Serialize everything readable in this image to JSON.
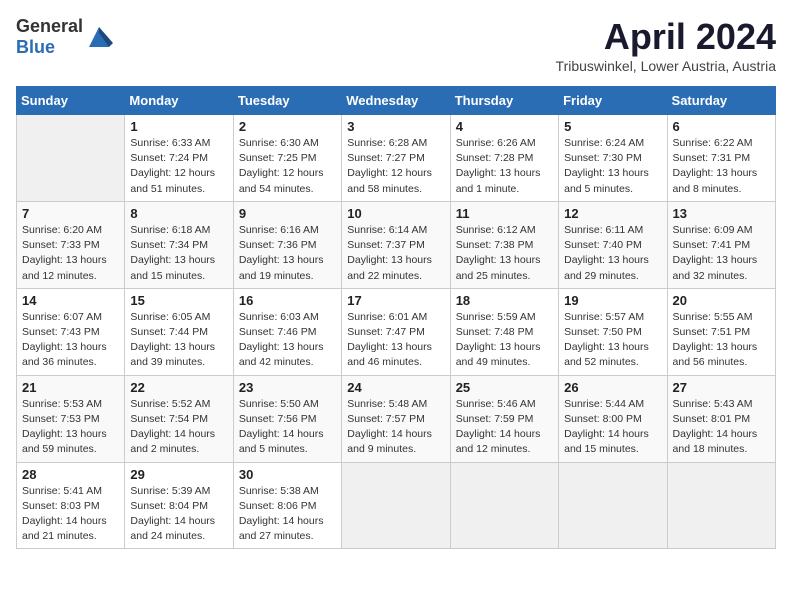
{
  "header": {
    "logo_general": "General",
    "logo_blue": "Blue",
    "month": "April 2024",
    "location": "Tribuswinkel, Lower Austria, Austria"
  },
  "weekdays": [
    "Sunday",
    "Monday",
    "Tuesday",
    "Wednesday",
    "Thursday",
    "Friday",
    "Saturday"
  ],
  "weeks": [
    [
      {
        "day": "",
        "info": ""
      },
      {
        "day": "1",
        "info": "Sunrise: 6:33 AM\nSunset: 7:24 PM\nDaylight: 12 hours\nand 51 minutes."
      },
      {
        "day": "2",
        "info": "Sunrise: 6:30 AM\nSunset: 7:25 PM\nDaylight: 12 hours\nand 54 minutes."
      },
      {
        "day": "3",
        "info": "Sunrise: 6:28 AM\nSunset: 7:27 PM\nDaylight: 12 hours\nand 58 minutes."
      },
      {
        "day": "4",
        "info": "Sunrise: 6:26 AM\nSunset: 7:28 PM\nDaylight: 13 hours\nand 1 minute."
      },
      {
        "day": "5",
        "info": "Sunrise: 6:24 AM\nSunset: 7:30 PM\nDaylight: 13 hours\nand 5 minutes."
      },
      {
        "day": "6",
        "info": "Sunrise: 6:22 AM\nSunset: 7:31 PM\nDaylight: 13 hours\nand 8 minutes."
      }
    ],
    [
      {
        "day": "7",
        "info": "Sunrise: 6:20 AM\nSunset: 7:33 PM\nDaylight: 13 hours\nand 12 minutes."
      },
      {
        "day": "8",
        "info": "Sunrise: 6:18 AM\nSunset: 7:34 PM\nDaylight: 13 hours\nand 15 minutes."
      },
      {
        "day": "9",
        "info": "Sunrise: 6:16 AM\nSunset: 7:36 PM\nDaylight: 13 hours\nand 19 minutes."
      },
      {
        "day": "10",
        "info": "Sunrise: 6:14 AM\nSunset: 7:37 PM\nDaylight: 13 hours\nand 22 minutes."
      },
      {
        "day": "11",
        "info": "Sunrise: 6:12 AM\nSunset: 7:38 PM\nDaylight: 13 hours\nand 25 minutes."
      },
      {
        "day": "12",
        "info": "Sunrise: 6:11 AM\nSunset: 7:40 PM\nDaylight: 13 hours\nand 29 minutes."
      },
      {
        "day": "13",
        "info": "Sunrise: 6:09 AM\nSunset: 7:41 PM\nDaylight: 13 hours\nand 32 minutes."
      }
    ],
    [
      {
        "day": "14",
        "info": "Sunrise: 6:07 AM\nSunset: 7:43 PM\nDaylight: 13 hours\nand 36 minutes."
      },
      {
        "day": "15",
        "info": "Sunrise: 6:05 AM\nSunset: 7:44 PM\nDaylight: 13 hours\nand 39 minutes."
      },
      {
        "day": "16",
        "info": "Sunrise: 6:03 AM\nSunset: 7:46 PM\nDaylight: 13 hours\nand 42 minutes."
      },
      {
        "day": "17",
        "info": "Sunrise: 6:01 AM\nSunset: 7:47 PM\nDaylight: 13 hours\nand 46 minutes."
      },
      {
        "day": "18",
        "info": "Sunrise: 5:59 AM\nSunset: 7:48 PM\nDaylight: 13 hours\nand 49 minutes."
      },
      {
        "day": "19",
        "info": "Sunrise: 5:57 AM\nSunset: 7:50 PM\nDaylight: 13 hours\nand 52 minutes."
      },
      {
        "day": "20",
        "info": "Sunrise: 5:55 AM\nSunset: 7:51 PM\nDaylight: 13 hours\nand 56 minutes."
      }
    ],
    [
      {
        "day": "21",
        "info": "Sunrise: 5:53 AM\nSunset: 7:53 PM\nDaylight: 13 hours\nand 59 minutes."
      },
      {
        "day": "22",
        "info": "Sunrise: 5:52 AM\nSunset: 7:54 PM\nDaylight: 14 hours\nand 2 minutes."
      },
      {
        "day": "23",
        "info": "Sunrise: 5:50 AM\nSunset: 7:56 PM\nDaylight: 14 hours\nand 5 minutes."
      },
      {
        "day": "24",
        "info": "Sunrise: 5:48 AM\nSunset: 7:57 PM\nDaylight: 14 hours\nand 9 minutes."
      },
      {
        "day": "25",
        "info": "Sunrise: 5:46 AM\nSunset: 7:59 PM\nDaylight: 14 hours\nand 12 minutes."
      },
      {
        "day": "26",
        "info": "Sunrise: 5:44 AM\nSunset: 8:00 PM\nDaylight: 14 hours\nand 15 minutes."
      },
      {
        "day": "27",
        "info": "Sunrise: 5:43 AM\nSunset: 8:01 PM\nDaylight: 14 hours\nand 18 minutes."
      }
    ],
    [
      {
        "day": "28",
        "info": "Sunrise: 5:41 AM\nSunset: 8:03 PM\nDaylight: 14 hours\nand 21 minutes."
      },
      {
        "day": "29",
        "info": "Sunrise: 5:39 AM\nSunset: 8:04 PM\nDaylight: 14 hours\nand 24 minutes."
      },
      {
        "day": "30",
        "info": "Sunrise: 5:38 AM\nSunset: 8:06 PM\nDaylight: 14 hours\nand 27 minutes."
      },
      {
        "day": "",
        "info": ""
      },
      {
        "day": "",
        "info": ""
      },
      {
        "day": "",
        "info": ""
      },
      {
        "day": "",
        "info": ""
      }
    ]
  ]
}
